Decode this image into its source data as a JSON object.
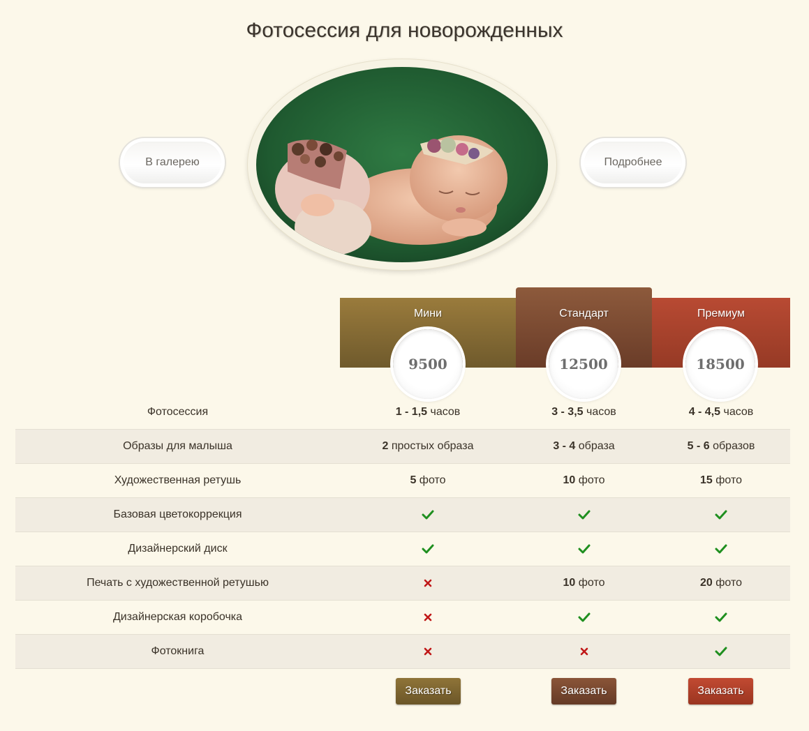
{
  "page": {
    "title": "Фотосессия для новорожденных"
  },
  "nav": {
    "gallery_label": "В галерею",
    "more_label": "Подробнее"
  },
  "colors": {
    "background": "#fcf8ea",
    "mini": "#8a6f35",
    "standard": "#7b4a33",
    "premium": "#a9402c",
    "check": "#1f8f1f",
    "cross": "#c01818"
  },
  "plans": [
    {
      "name": "Мини",
      "price": "9500"
    },
    {
      "name": "Стандарт",
      "price": "12500"
    },
    {
      "name": "Премиум",
      "price": "18500"
    }
  ],
  "rows": [
    {
      "label": "Фотосессия",
      "cells": [
        {
          "type": "text",
          "bold": "1 - 1,5",
          "text": " часов"
        },
        {
          "type": "text",
          "bold": "3 - 3,5",
          "text": " часов"
        },
        {
          "type": "text",
          "bold": "4 - 4,5",
          "text": " часов"
        }
      ]
    },
    {
      "label": "Образы для малыша",
      "cells": [
        {
          "type": "text",
          "bold": "2",
          "text": " простых образа"
        },
        {
          "type": "text",
          "bold": "3 - 4",
          "text": " образа"
        },
        {
          "type": "text",
          "bold": "5 - 6",
          "text": " образов"
        }
      ]
    },
    {
      "label": "Художественная ретушь",
      "cells": [
        {
          "type": "text",
          "bold": "5",
          "text": " фото"
        },
        {
          "type": "text",
          "bold": "10",
          "text": " фото"
        },
        {
          "type": "text",
          "bold": "15",
          "text": " фото"
        }
      ]
    },
    {
      "label": "Базовая цветокоррекция",
      "cells": [
        {
          "type": "check"
        },
        {
          "type": "check"
        },
        {
          "type": "check"
        }
      ]
    },
    {
      "label": "Дизайнерский диск",
      "cells": [
        {
          "type": "check"
        },
        {
          "type": "check"
        },
        {
          "type": "check"
        }
      ]
    },
    {
      "label": "Печать с художественной ретушью",
      "cells": [
        {
          "type": "cross"
        },
        {
          "type": "text",
          "bold": "10",
          "text": " фото"
        },
        {
          "type": "text",
          "bold": "20",
          "text": " фото"
        }
      ]
    },
    {
      "label": "Дизайнерская коробочка",
      "cells": [
        {
          "type": "cross"
        },
        {
          "type": "check"
        },
        {
          "type": "check"
        }
      ]
    },
    {
      "label": "Фотокнига",
      "cells": [
        {
          "type": "cross"
        },
        {
          "type": "cross"
        },
        {
          "type": "check"
        }
      ]
    }
  ],
  "order": {
    "label": "Заказать"
  }
}
